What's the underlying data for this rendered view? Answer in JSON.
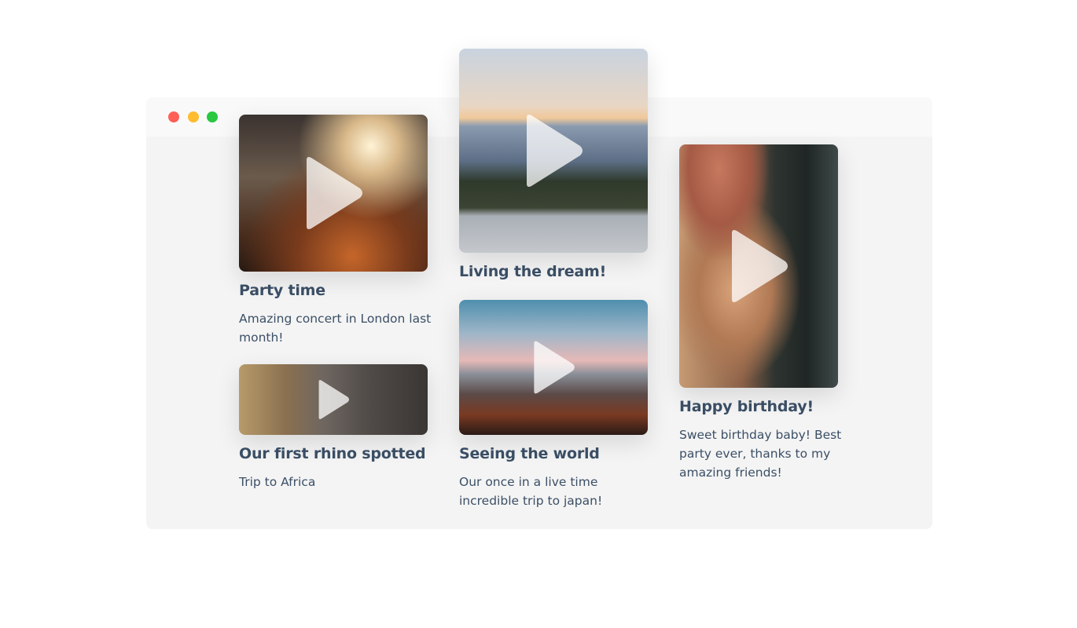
{
  "window": {
    "controls": [
      {
        "name": "close",
        "color": "#ff5f57"
      },
      {
        "name": "minimize",
        "color": "#febc2e"
      },
      {
        "name": "maximize",
        "color": "#28c840"
      }
    ]
  },
  "cards": [
    {
      "title": "Party time",
      "description": "Amazing concert in London last month!",
      "icon": "play-icon"
    },
    {
      "title": "Our first rhino spotted",
      "description": "Trip to Africa",
      "icon": "play-icon"
    },
    {
      "title": "Living the dream!",
      "icon": "play-icon"
    },
    {
      "title": "Seeing the world",
      "description": "Our once in a live time incredible trip to japan!",
      "icon": "play-icon"
    },
    {
      "title": "Happy birthday!",
      "description": "Sweet birthday baby! Best party ever, thanks to my amazing friends!",
      "icon": "play-icon"
    }
  ]
}
